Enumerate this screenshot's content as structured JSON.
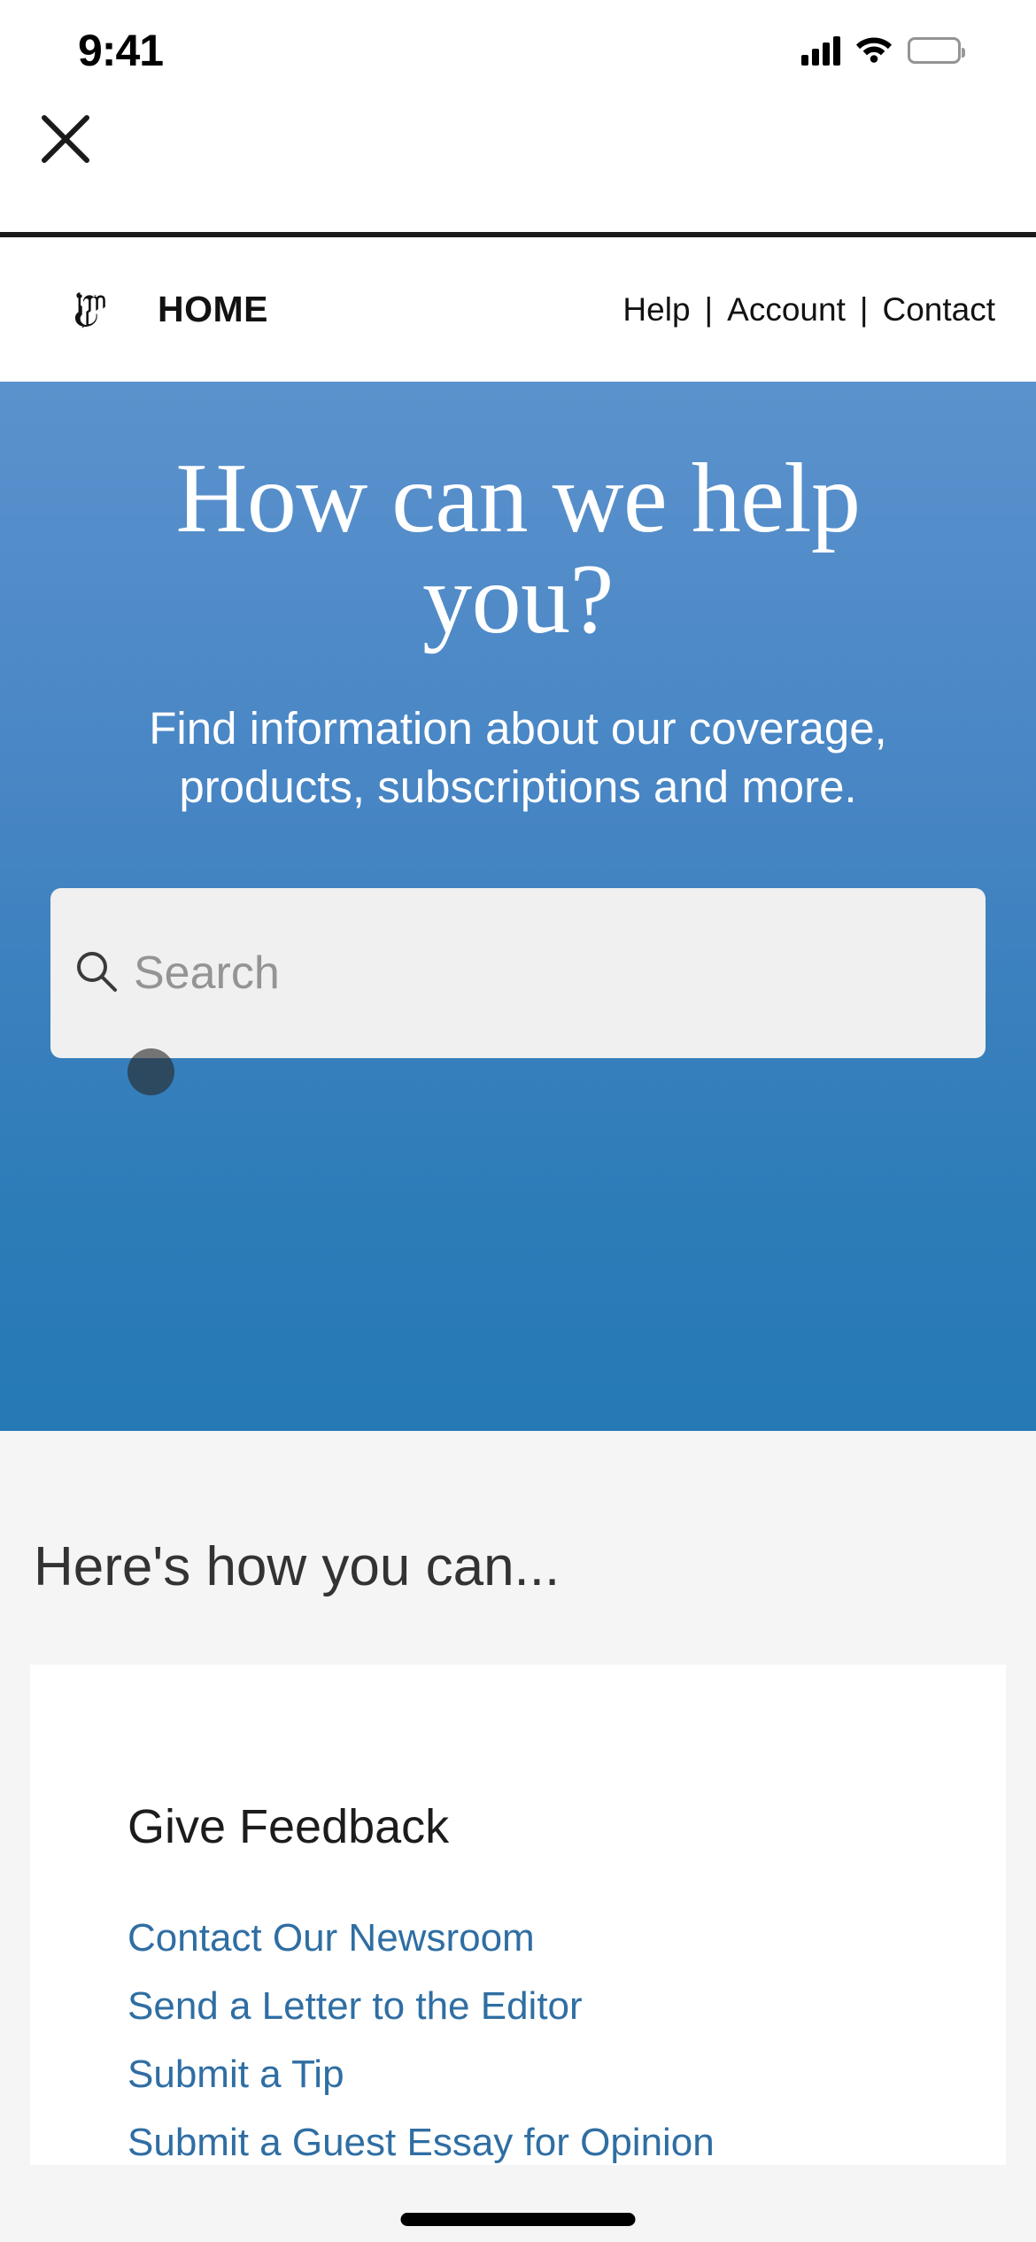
{
  "status_bar": {
    "time": "9:41",
    "signal_icon": "cellular-signal-icon",
    "wifi_icon": "wifi-icon",
    "battery_icon": "battery-full-icon"
  },
  "close_bar": {
    "close_icon": "close-x-icon"
  },
  "nav": {
    "logo_icon": "nyt-t-logo-icon",
    "home_label": "HOME",
    "separator": "|",
    "links": [
      {
        "label": "Help"
      },
      {
        "label": "Account"
      },
      {
        "label": "Contact"
      }
    ]
  },
  "hero": {
    "title_line1": "How can we help",
    "title_line2": "you?",
    "subtitle": "Find information about our coverage, products, subscriptions and more.",
    "gradient_top": "#5b92cd",
    "gradient_bottom": "#2579b5",
    "search": {
      "icon": "search-magnifier-icon",
      "placeholder": "Search",
      "value": ""
    }
  },
  "lower": {
    "section_title": "Here's how you can...",
    "card": {
      "title": "Give Feedback",
      "links": [
        {
          "label": "Contact Our Newsroom"
        },
        {
          "label": "Send a Letter to the Editor"
        },
        {
          "label": "Submit a Tip"
        },
        {
          "label": "Submit a Guest Essay for Opinion"
        }
      ],
      "link_color": "#2f6ea3"
    }
  },
  "home_indicator": "home-indicator-bar"
}
